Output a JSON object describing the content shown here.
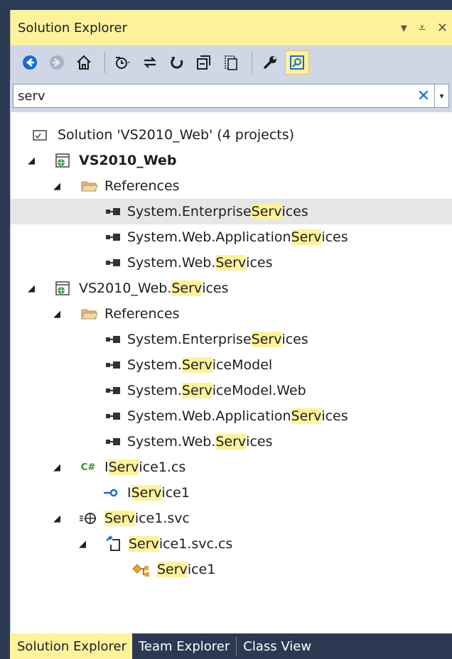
{
  "panel": {
    "title": "Solution Explorer",
    "pin_glyph": "⩡",
    "dropdown_glyph": "▾",
    "close_glyph": "✕"
  },
  "toolbar": {
    "icons": [
      "back-icon",
      "forward-icon",
      "home-icon",
      "pending-changes-filter-icon",
      "sync-icon",
      "refresh-icon",
      "collapse-all-icon",
      "show-all-files-icon",
      "properties-icon",
      "preview-icon"
    ]
  },
  "search": {
    "value": "serv",
    "clear_glyph": "✕",
    "dropdown_glyph": "▾"
  },
  "tree": {
    "solution": {
      "label": "Solution 'VS2010_Web' (4 projects)"
    },
    "project1": {
      "label": "VS2010_Web",
      "references": {
        "label": "References",
        "items": [
          {
            "pre": "System.Enterprise",
            "hl": "Serv",
            "post": "ices"
          },
          {
            "pre": "System.Web.Application",
            "hl": "Serv",
            "post": "ices"
          },
          {
            "pre": "System.Web.",
            "hl": "Serv",
            "post": "ices"
          }
        ]
      }
    },
    "project2": {
      "pre": "VS2010_Web.",
      "hl": "Serv",
      "post": "ices",
      "references": {
        "label": "References",
        "items": [
          {
            "pre": "System.Enterprise",
            "hl": "Serv",
            "post": "ices"
          },
          {
            "pre": "System.",
            "hl": "Serv",
            "post": "iceModel"
          },
          {
            "pre": "System.",
            "hl": "Serv",
            "post": "iceModel.Web"
          },
          {
            "pre": "System.Web.Application",
            "hl": "Serv",
            "post": "ices"
          },
          {
            "pre": "System.Web.",
            "hl": "Serv",
            "post": "ices"
          }
        ]
      },
      "iservice_file": {
        "pre": "I",
        "hl": "Serv",
        "post": "ice1.cs"
      },
      "iservice_interface": {
        "pre": "I",
        "hl": "Serv",
        "post": "ice1"
      },
      "svc_file": {
        "pre": "",
        "hl": "Serv",
        "post": "ice1.svc"
      },
      "svc_cs_file": {
        "pre": "",
        "hl": "Serv",
        "post": "ice1.svc.cs"
      },
      "service_class": {
        "pre": "",
        "hl": "Serv",
        "post": "ice1"
      }
    }
  },
  "tabs": [
    {
      "label": "Solution Explorer"
    },
    {
      "label": "Team Explorer"
    },
    {
      "label": "Class View"
    }
  ],
  "colors": {
    "tab_active": "#fff29d",
    "highlight": "#fff29d",
    "chrome": "#2b3a52",
    "toolbar": "#cfd6e5"
  }
}
